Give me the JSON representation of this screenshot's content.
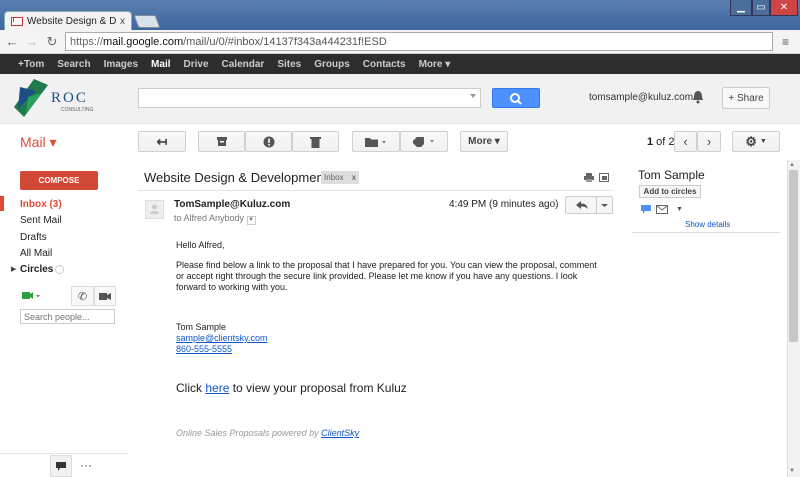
{
  "browser": {
    "tab_title": "Website Design & Develop",
    "tab_close": "x",
    "url_scheme": "https://",
    "url_domain": "mail.google.com",
    "url_path": "/mail/u/0/#inbox/14137f343a444231f!ESD"
  },
  "gbar": {
    "items": [
      "+Tom",
      "Search",
      "Images",
      "Mail",
      "Drive",
      "Calendar",
      "Sites",
      "Groups",
      "Contacts",
      "More ▾"
    ],
    "active": "Mail"
  },
  "header": {
    "logo_text": "ROC",
    "logo_sub": "CONSULTING",
    "account": "tomsample@kuluz.com",
    "share_label": "+ Share"
  },
  "mailbar": {
    "title": "Mail ▾",
    "more_label": "More ▾",
    "pager_current": "1",
    "pager_total": " of 2"
  },
  "leftnav": {
    "compose": "COMPOSE",
    "items": [
      "Inbox (3)",
      "Sent Mail",
      "Drafts",
      "All Mail"
    ],
    "circles": "Circles",
    "search_people_placeholder": "Search people..."
  },
  "message": {
    "subject": "Website Design & Development",
    "label": "Inbox",
    "label_x": "x",
    "sender": "TomSample@Kuluz.com",
    "to": "to Alfred Anybody",
    "time": "4:49 PM (9 minutes ago)",
    "greeting": "Hello Alfred,",
    "para": "Please find below a link to the proposal that I have prepared for you. You can view the proposal, comment or accept right through the secure link provided. Please let me know if you have any questions. I look forward to working with you.",
    "sig_name": "Tom Sample",
    "sig_email": "sample@clientsky.com",
    "sig_phone": "860-555-5555",
    "click_pre": "Click ",
    "click_link": "here",
    "click_post": " to view your proposal from Kuluz",
    "footer_pre": "Online Sales Proposals powered by ",
    "footer_link": "ClientSky"
  },
  "rightpanel": {
    "name": "Tom Sample",
    "add_circles": "Add to circles",
    "show_details": "Show details"
  },
  "colors": {
    "accent": "#dd4b39",
    "blue": "#4d90fe",
    "link": "#1155cc"
  }
}
